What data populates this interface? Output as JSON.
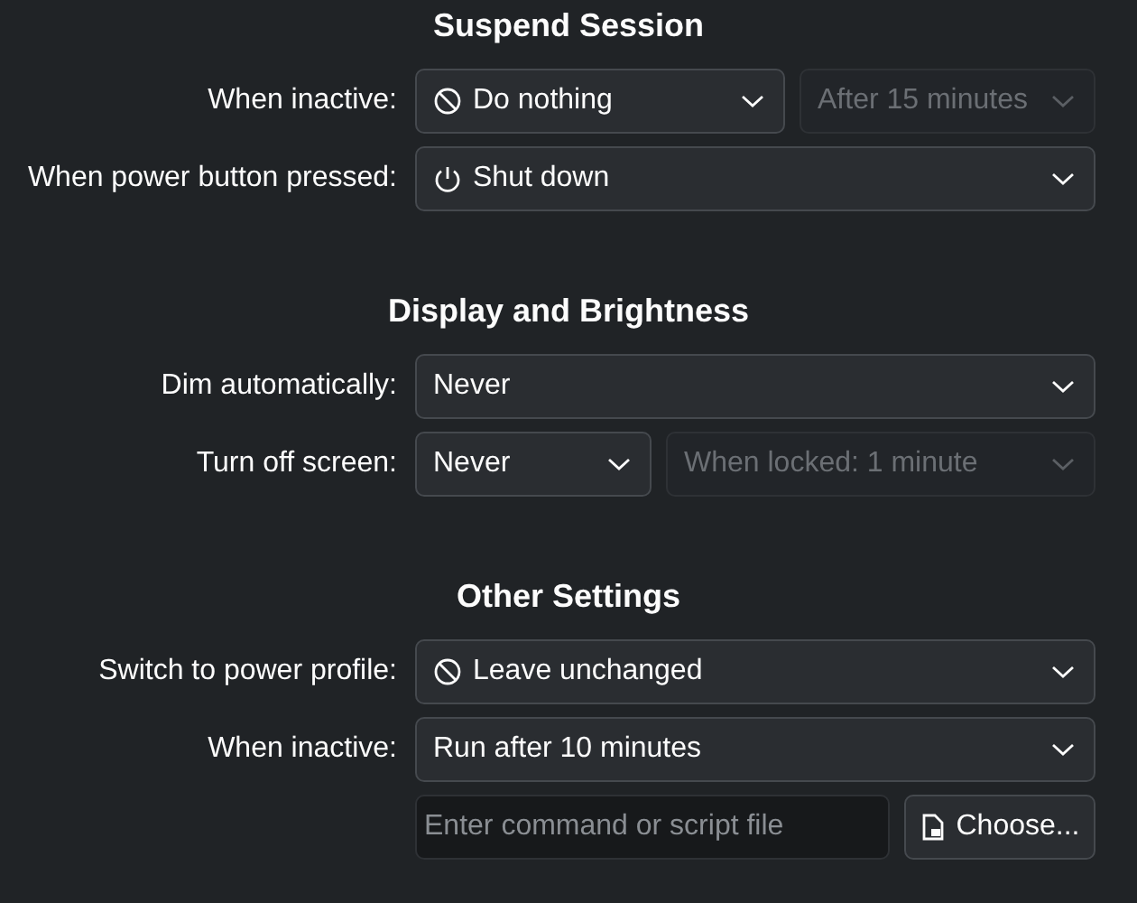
{
  "sections": [
    {
      "title": "Suspend Session",
      "rows": [
        {
          "label": "When inactive:",
          "controls": [
            {
              "kind": "combo",
              "value": "Do nothing",
              "disabled": false
            },
            {
              "kind": "combo",
              "value": "After 15 minutes",
              "disabled": true
            }
          ]
        },
        {
          "label": "When power button pressed:",
          "controls": [
            {
              "kind": "combo",
              "value": "Shut down",
              "disabled": false
            }
          ]
        }
      ]
    },
    {
      "title": "Display and Brightness",
      "rows": [
        {
          "label": "Dim automatically:",
          "controls": [
            {
              "kind": "combo",
              "value": "Never",
              "disabled": false
            }
          ]
        },
        {
          "label": "Turn off screen:",
          "controls": [
            {
              "kind": "combo",
              "value": "Never",
              "disabled": false
            },
            {
              "kind": "combo",
              "value": "When locked: 1 minute",
              "disabled": true
            }
          ]
        }
      ]
    },
    {
      "title": "Other Settings",
      "rows": [
        {
          "label": "Switch to power profile:",
          "controls": [
            {
              "kind": "combo",
              "value": "Leave unchanged",
              "disabled": false
            }
          ]
        },
        {
          "label": "When inactive:",
          "controls": [
            {
              "kind": "combo",
              "value": "Run after 10 minutes",
              "disabled": false
            }
          ]
        },
        {
          "controls": [
            {
              "kind": "field",
              "placeholder": "Enter command or script file"
            },
            {
              "kind": "button",
              "value": "Choose..."
            }
          ]
        }
      ]
    }
  ]
}
